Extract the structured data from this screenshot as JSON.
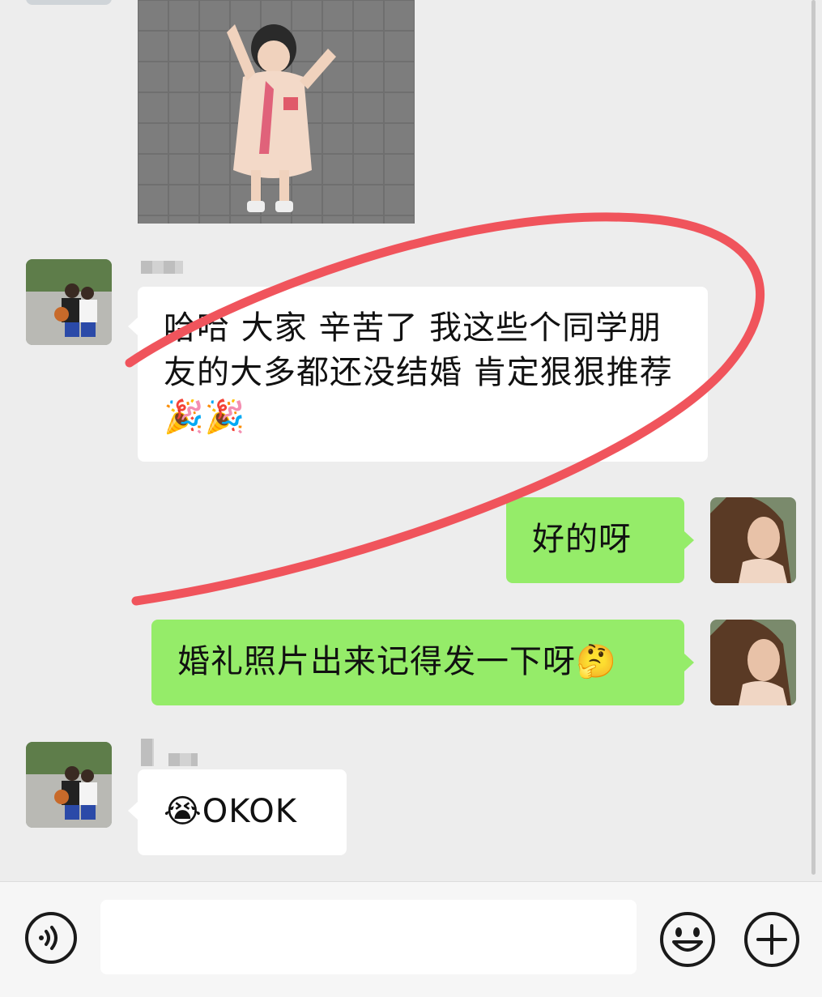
{
  "messages": [
    {
      "side": "left",
      "type": "image"
    },
    {
      "side": "left",
      "type": "text",
      "text": "哈哈  大家 辛苦了  我这些个同学朋友的大多都还没结婚  肯定狠狠推荐🎉🎉"
    },
    {
      "side": "right",
      "type": "text",
      "text": "好的呀"
    },
    {
      "side": "right",
      "type": "text",
      "text": "婚礼照片出来记得发一下呀🤔"
    },
    {
      "side": "left",
      "type": "text",
      "text": "😭OKOK"
    }
  ],
  "input": {
    "placeholder": ""
  },
  "icons": {
    "voice": "voice-icon",
    "emoji": "emoji-icon",
    "more": "add-icon"
  },
  "colors": {
    "background": "#ededed",
    "bubble_left": "#ffffff",
    "bubble_right": "#95ec69",
    "annotation": "#f0545c"
  }
}
